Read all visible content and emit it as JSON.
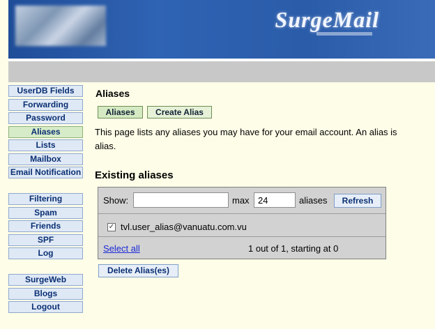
{
  "banner": {
    "logo": "SurgeMail"
  },
  "sidebar": {
    "group1": [
      "UserDB Fields",
      "Forwarding",
      "Password",
      "Aliases",
      "Lists",
      "Mailbox",
      "Email Notification"
    ],
    "group2": [
      "Filtering",
      "Spam",
      "Friends",
      "SPF",
      "Log"
    ],
    "group3": [
      "SurgeWeb",
      "Blogs",
      "Logout"
    ],
    "active": "Aliases"
  },
  "main": {
    "heading": "Aliases",
    "tabs": [
      "Aliases",
      "Create Alias"
    ],
    "description_line1": "This page lists any aliases you may have for your email account.   An alias is",
    "description_line2": "alias.",
    "existing_heading": "Existing aliases"
  },
  "list": {
    "show_label": "Show:",
    "show_value": "",
    "max_label": "max",
    "max_value": "24",
    "aliases_label": "aliases",
    "refresh_label": "Refresh",
    "items": [
      {
        "email": "tvl.user_alias@vanuatu.com.vu",
        "checked": true
      }
    ],
    "select_all": "Select all",
    "count_text": "1 out of 1, starting at 0",
    "delete_label": "Delete Alias(es)"
  }
}
